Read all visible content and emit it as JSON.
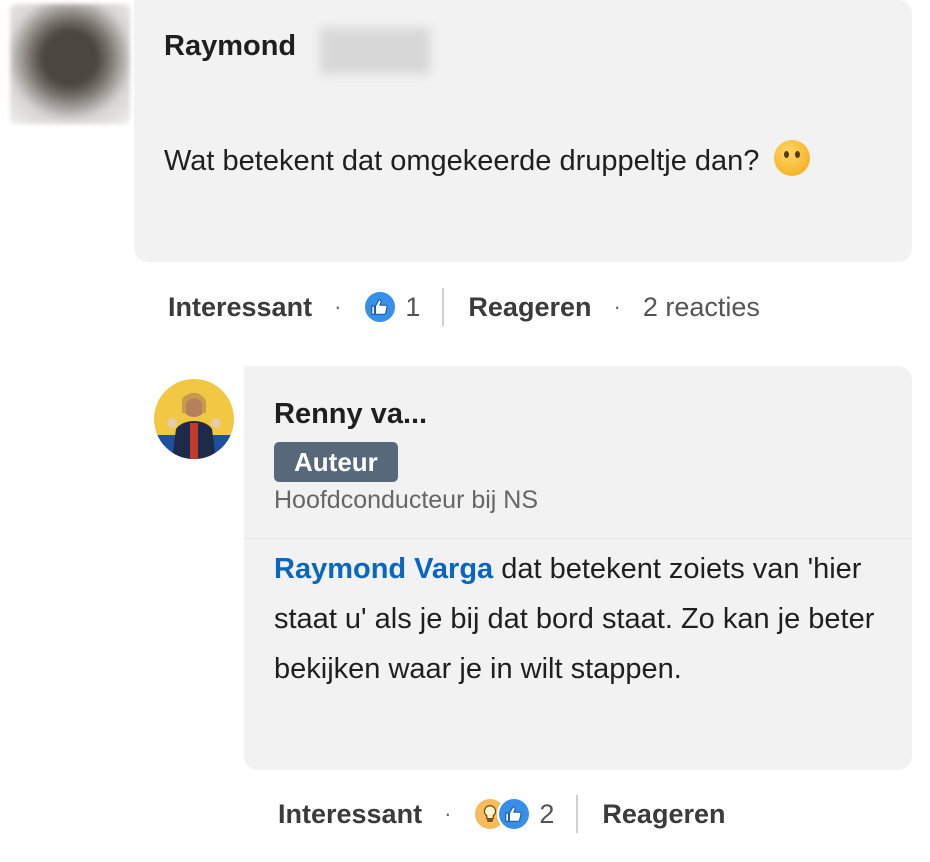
{
  "comment": {
    "author_first": "Raymond",
    "text": "Wat betekent dat omgekeerde druppeltje dan?",
    "emoji": "thinking-face",
    "actions": {
      "interesting_label": "Interessant",
      "reaction_count": "1",
      "reply_label": "Reageren",
      "replies_count": "2 reacties"
    }
  },
  "reply": {
    "author": "Renny va...",
    "badge": "Auteur",
    "headline": "Hoofdconducteur bij NS",
    "mention": "Raymond Varga",
    "text": "dat betekent zoiets van 'hier staat u' als je bij dat bord staat. Zo kan je beter bekijken waar je in wilt stappen.",
    "actions": {
      "interesting_label": "Interessant",
      "reaction_count": "2",
      "reply_label": "Reageren"
    }
  },
  "colors": {
    "link": "#0a66c2",
    "badge_bg": "#56687a",
    "bubble_bg": "#f2f2f2",
    "like": "#378fe9",
    "insightful": "#f5bb5c"
  }
}
